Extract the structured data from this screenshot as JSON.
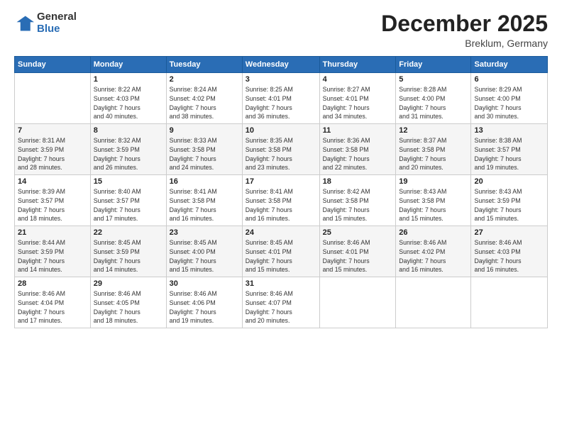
{
  "logo": {
    "general": "General",
    "blue": "Blue"
  },
  "header": {
    "month": "December 2025",
    "location": "Breklum, Germany"
  },
  "weekdays": [
    "Sunday",
    "Monday",
    "Tuesday",
    "Wednesday",
    "Thursday",
    "Friday",
    "Saturday"
  ],
  "weeks": [
    [
      {
        "day": "",
        "info": ""
      },
      {
        "day": "1",
        "info": "Sunrise: 8:22 AM\nSunset: 4:03 PM\nDaylight: 7 hours\nand 40 minutes."
      },
      {
        "day": "2",
        "info": "Sunrise: 8:24 AM\nSunset: 4:02 PM\nDaylight: 7 hours\nand 38 minutes."
      },
      {
        "day": "3",
        "info": "Sunrise: 8:25 AM\nSunset: 4:01 PM\nDaylight: 7 hours\nand 36 minutes."
      },
      {
        "day": "4",
        "info": "Sunrise: 8:27 AM\nSunset: 4:01 PM\nDaylight: 7 hours\nand 34 minutes."
      },
      {
        "day": "5",
        "info": "Sunrise: 8:28 AM\nSunset: 4:00 PM\nDaylight: 7 hours\nand 31 minutes."
      },
      {
        "day": "6",
        "info": "Sunrise: 8:29 AM\nSunset: 4:00 PM\nDaylight: 7 hours\nand 30 minutes."
      }
    ],
    [
      {
        "day": "7",
        "info": "Sunrise: 8:31 AM\nSunset: 3:59 PM\nDaylight: 7 hours\nand 28 minutes."
      },
      {
        "day": "8",
        "info": "Sunrise: 8:32 AM\nSunset: 3:59 PM\nDaylight: 7 hours\nand 26 minutes."
      },
      {
        "day": "9",
        "info": "Sunrise: 8:33 AM\nSunset: 3:58 PM\nDaylight: 7 hours\nand 24 minutes."
      },
      {
        "day": "10",
        "info": "Sunrise: 8:35 AM\nSunset: 3:58 PM\nDaylight: 7 hours\nand 23 minutes."
      },
      {
        "day": "11",
        "info": "Sunrise: 8:36 AM\nSunset: 3:58 PM\nDaylight: 7 hours\nand 22 minutes."
      },
      {
        "day": "12",
        "info": "Sunrise: 8:37 AM\nSunset: 3:58 PM\nDaylight: 7 hours\nand 20 minutes."
      },
      {
        "day": "13",
        "info": "Sunrise: 8:38 AM\nSunset: 3:57 PM\nDaylight: 7 hours\nand 19 minutes."
      }
    ],
    [
      {
        "day": "14",
        "info": "Sunrise: 8:39 AM\nSunset: 3:57 PM\nDaylight: 7 hours\nand 18 minutes."
      },
      {
        "day": "15",
        "info": "Sunrise: 8:40 AM\nSunset: 3:57 PM\nDaylight: 7 hours\nand 17 minutes."
      },
      {
        "day": "16",
        "info": "Sunrise: 8:41 AM\nSunset: 3:58 PM\nDaylight: 7 hours\nand 16 minutes."
      },
      {
        "day": "17",
        "info": "Sunrise: 8:41 AM\nSunset: 3:58 PM\nDaylight: 7 hours\nand 16 minutes."
      },
      {
        "day": "18",
        "info": "Sunrise: 8:42 AM\nSunset: 3:58 PM\nDaylight: 7 hours\nand 15 minutes."
      },
      {
        "day": "19",
        "info": "Sunrise: 8:43 AM\nSunset: 3:58 PM\nDaylight: 7 hours\nand 15 minutes."
      },
      {
        "day": "20",
        "info": "Sunrise: 8:43 AM\nSunset: 3:59 PM\nDaylight: 7 hours\nand 15 minutes."
      }
    ],
    [
      {
        "day": "21",
        "info": "Sunrise: 8:44 AM\nSunset: 3:59 PM\nDaylight: 7 hours\nand 14 minutes."
      },
      {
        "day": "22",
        "info": "Sunrise: 8:45 AM\nSunset: 3:59 PM\nDaylight: 7 hours\nand 14 minutes."
      },
      {
        "day": "23",
        "info": "Sunrise: 8:45 AM\nSunset: 4:00 PM\nDaylight: 7 hours\nand 15 minutes."
      },
      {
        "day": "24",
        "info": "Sunrise: 8:45 AM\nSunset: 4:01 PM\nDaylight: 7 hours\nand 15 minutes."
      },
      {
        "day": "25",
        "info": "Sunrise: 8:46 AM\nSunset: 4:01 PM\nDaylight: 7 hours\nand 15 minutes."
      },
      {
        "day": "26",
        "info": "Sunrise: 8:46 AM\nSunset: 4:02 PM\nDaylight: 7 hours\nand 16 minutes."
      },
      {
        "day": "27",
        "info": "Sunrise: 8:46 AM\nSunset: 4:03 PM\nDaylight: 7 hours\nand 16 minutes."
      }
    ],
    [
      {
        "day": "28",
        "info": "Sunrise: 8:46 AM\nSunset: 4:04 PM\nDaylight: 7 hours\nand 17 minutes."
      },
      {
        "day": "29",
        "info": "Sunrise: 8:46 AM\nSunset: 4:05 PM\nDaylight: 7 hours\nand 18 minutes."
      },
      {
        "day": "30",
        "info": "Sunrise: 8:46 AM\nSunset: 4:06 PM\nDaylight: 7 hours\nand 19 minutes."
      },
      {
        "day": "31",
        "info": "Sunrise: 8:46 AM\nSunset: 4:07 PM\nDaylight: 7 hours\nand 20 minutes."
      },
      {
        "day": "",
        "info": ""
      },
      {
        "day": "",
        "info": ""
      },
      {
        "day": "",
        "info": ""
      }
    ]
  ]
}
